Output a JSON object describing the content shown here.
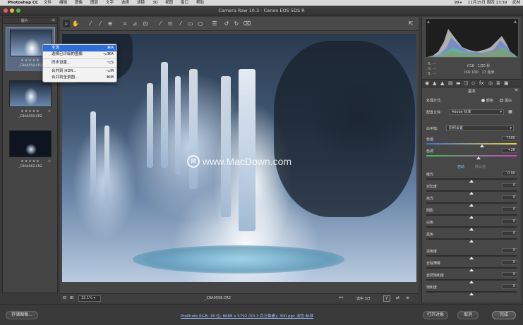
{
  "menubar": {
    "app_name": "Photoshop CC",
    "items": [
      "文件",
      "编辑",
      "图像",
      "图层",
      "文字",
      "选择",
      "滤镜",
      "3D",
      "视图",
      "窗口",
      "帮助"
    ],
    "status": [
      "99+",
      "11月15日 周四 13:39",
      "武林"
    ]
  },
  "window": {
    "title": "Camera Raw 10.3 - Canon EOS 5DS R"
  },
  "filmstrip": {
    "title": "胶片",
    "items": [
      {
        "name": "_C8A0558.CR2",
        "rating": "★★★★★",
        "selected": true
      },
      {
        "name": "_C8A0559.CR2",
        "rating": "★★★★★",
        "selected": false
      },
      {
        "name": "_C8A0562.CR2",
        "rating": "★★★★★",
        "selected": false
      }
    ]
  },
  "context_menu": {
    "items": [
      {
        "label": "全选",
        "shortcut": "⌘A",
        "highlighted": true
      },
      {
        "label": "选择已评级的图像",
        "shortcut": "⌥⌘A"
      },
      {
        "label": "同步设置...",
        "shortcut": "⌥S"
      },
      {
        "label": "合并到 HDR...",
        "shortcut": "⌥M"
      },
      {
        "label": "合并到全景图...",
        "shortcut": "⌘M"
      }
    ]
  },
  "canvas": {
    "watermark": "www.MacDown.com",
    "zoom": "22.1%",
    "filename": "_C8A0558.CR2",
    "selection_count": "选中 3/3"
  },
  "histogram": {
    "r": "R: ---",
    "g": "G: ---",
    "b": "B: ---",
    "aperture": "f/16",
    "shutter": "1/30 秒",
    "iso": "ISO 100",
    "focal": "17 毫米"
  },
  "panel": {
    "title": "基本",
    "treatment_label": "处理方式:",
    "treatment_color": "颜色",
    "treatment_bw": "黑白",
    "profile_label": "配置文件:",
    "profile_value": "Adobe 标准",
    "wb_label": "白平衡:",
    "wb_value": "原照设置",
    "sliders": [
      {
        "label": "色温",
        "value": "7500",
        "pos": 0.62
      },
      {
        "label": "色调",
        "value": "+26",
        "pos": 0.58
      }
    ],
    "auto_label": "自动",
    "default_label": "默认值",
    "tone_sliders": [
      {
        "label": "曝光",
        "value": "0.00",
        "pos": 0.5
      },
      {
        "label": "对比度",
        "value": "0",
        "pos": 0.5
      },
      {
        "label": "高光",
        "value": "0",
        "pos": 0.5
      },
      {
        "label": "阴影",
        "value": "0",
        "pos": 0.5
      },
      {
        "label": "白色",
        "value": "0",
        "pos": 0.5
      },
      {
        "label": "黑色",
        "value": "0",
        "pos": 0.5
      },
      {
        "label": "清晰度",
        "value": "0",
        "pos": 0.5
      },
      {
        "label": "去除薄雾",
        "value": "0",
        "pos": 0.5
      },
      {
        "label": "自然饱和度",
        "value": "0",
        "pos": 0.5
      },
      {
        "label": "饱和度",
        "value": "0",
        "pos": 0.5
      }
    ]
  },
  "bottombar": {
    "save_label": "存储图像...",
    "workflow_text": "ProPhoto RGB; 16 位; 8688 x 5792 (50.3 百万像素); 300 ppi; 滤色:标准",
    "open_label": "打开对象",
    "cancel_label": "取消",
    "done_label": "完成"
  },
  "colors": {
    "accent": "#2d6ed8",
    "panel_bg": "#474747",
    "app_bg": "#3a3a3a"
  },
  "toolbar_icons": [
    "zoom-icon",
    "hand-icon",
    "white-balance-icon",
    "color-sampler-icon",
    "targeted-adjust-icon",
    "crop-icon",
    "straighten-icon",
    "transform-icon",
    "spot-removal-icon",
    "red-eye-icon",
    "adjustment-brush-icon",
    "graduated-filter-icon",
    "radial-filter-icon",
    "preferences-icon",
    "rotate-left-icon",
    "rotate-right-icon",
    "trash-icon",
    "fullscreen-icon"
  ]
}
